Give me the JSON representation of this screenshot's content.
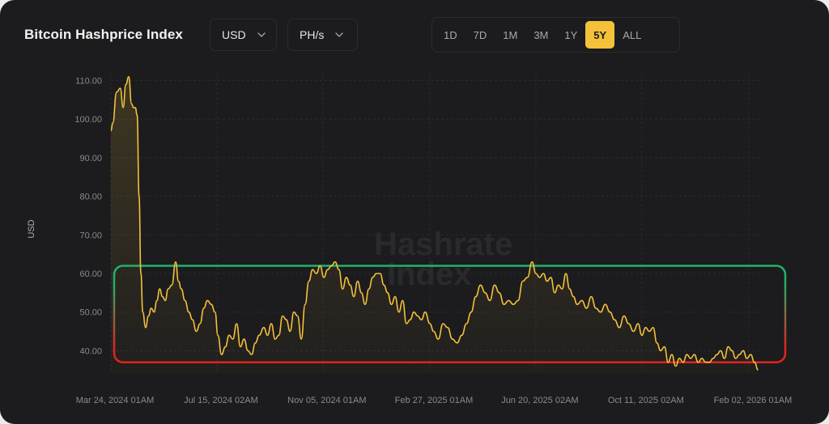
{
  "header": {
    "title": "Bitcoin Hashprice Index",
    "currency_select": "USD",
    "unit_select": "PH/s",
    "ranges": [
      "1D",
      "7D",
      "1M",
      "3M",
      "1Y",
      "5Y",
      "ALL"
    ],
    "active_range": "5Y"
  },
  "watermark": [
    "Hashrate",
    "Index"
  ],
  "colors": {
    "line": "#f3c13a",
    "accent": "#f3c13a",
    "band_top": "#1db36a",
    "band_bottom": "#e0251e",
    "background": "#1c1c1e"
  },
  "chart_data": {
    "type": "area",
    "ylabel": "USD",
    "ylim": [
      34,
      112
    ],
    "yticks": [
      40,
      50,
      60,
      70,
      80,
      90,
      100,
      110
    ],
    "ytick_labels": [
      "40.00",
      "50.00",
      "60.00",
      "70.00",
      "80.00",
      "90.00",
      "100.00",
      "110.00"
    ],
    "xlim": [
      "2024-03-24",
      "2026-02-15"
    ],
    "xticks": [
      "2024-03-24",
      "2024-07-15",
      "2024-11-05",
      "2025-02-27",
      "2025-06-20",
      "2025-10-11",
      "2026-02-02"
    ],
    "xtick_labels": [
      "Mar 24, 2024 01AM",
      "Jul 15, 2024 02AM",
      "Nov 05, 2024 01AM",
      "Feb 27, 2025 01AM",
      "Jun 20, 2025 02AM",
      "Oct 11, 2025 02AM",
      "Feb 02, 2026 01AM"
    ],
    "grid": true,
    "band": {
      "low": 37,
      "high": 62
    },
    "series": [
      {
        "x": [
          "2024-03-24",
          "2024-03-26",
          "2024-03-30",
          "2024-04-03",
          "2024-04-06",
          "2024-04-09",
          "2024-04-12",
          "2024-04-15",
          "2024-04-17",
          "2024-04-19",
          "2024-04-21",
          "2024-04-23",
          "2024-04-25",
          "2024-04-27",
          "2024-04-30",
          "2024-05-03",
          "2024-05-06",
          "2024-05-09",
          "2024-05-12",
          "2024-05-15",
          "2024-05-18",
          "2024-05-21",
          "2024-05-24",
          "2024-05-28",
          "2024-06-01",
          "2024-06-04",
          "2024-06-07",
          "2024-06-11",
          "2024-06-15",
          "2024-06-19",
          "2024-06-23",
          "2024-06-27",
          "2024-07-01",
          "2024-07-05",
          "2024-07-09",
          "2024-07-13",
          "2024-07-16",
          "2024-07-20",
          "2024-07-24",
          "2024-07-28",
          "2024-08-01",
          "2024-08-05",
          "2024-08-09",
          "2024-08-13",
          "2024-08-17",
          "2024-08-21",
          "2024-08-25",
          "2024-08-29",
          "2024-09-03",
          "2024-09-07",
          "2024-09-11",
          "2024-09-15",
          "2024-09-19",
          "2024-09-23",
          "2024-09-27",
          "2024-10-01",
          "2024-10-05",
          "2024-10-09",
          "2024-10-13",
          "2024-10-17",
          "2024-10-21",
          "2024-10-25",
          "2024-10-29",
          "2024-11-02",
          "2024-11-06",
          "2024-11-10",
          "2024-11-14",
          "2024-11-18",
          "2024-11-22",
          "2024-11-26",
          "2024-11-30",
          "2024-12-04",
          "2024-12-08",
          "2024-12-12",
          "2024-12-16",
          "2024-12-20",
          "2024-12-24",
          "2024-12-28",
          "2025-01-01",
          "2025-01-05",
          "2025-01-09",
          "2025-01-13",
          "2025-01-17",
          "2025-01-21",
          "2025-01-25",
          "2025-01-29",
          "2025-02-02",
          "2025-02-06",
          "2025-02-10",
          "2025-02-14",
          "2025-02-18",
          "2025-02-22",
          "2025-02-27",
          "2025-03-03",
          "2025-03-08",
          "2025-03-13",
          "2025-03-18",
          "2025-03-23",
          "2025-03-28",
          "2025-04-02",
          "2025-04-07",
          "2025-04-12",
          "2025-04-17",
          "2025-04-22",
          "2025-04-27",
          "2025-05-02",
          "2025-05-07",
          "2025-05-12",
          "2025-05-17",
          "2025-05-22",
          "2025-05-27",
          "2025-06-01",
          "2025-06-06",
          "2025-06-11",
          "2025-06-16",
          "2025-06-20",
          "2025-06-24",
          "2025-06-28",
          "2025-07-02",
          "2025-07-06",
          "2025-07-10",
          "2025-07-14",
          "2025-07-18",
          "2025-07-22",
          "2025-07-26",
          "2025-07-30",
          "2025-08-03",
          "2025-08-08",
          "2025-08-13",
          "2025-08-18",
          "2025-08-23",
          "2025-08-28",
          "2025-09-02",
          "2025-09-07",
          "2025-09-12",
          "2025-09-17",
          "2025-09-22",
          "2025-09-27",
          "2025-10-02",
          "2025-10-07",
          "2025-10-11",
          "2025-10-15",
          "2025-10-19",
          "2025-10-23",
          "2025-10-27",
          "2025-10-31",
          "2025-11-04",
          "2025-11-08",
          "2025-11-12",
          "2025-11-16",
          "2025-11-20",
          "2025-11-24",
          "2025-11-28",
          "2025-12-02",
          "2025-12-06",
          "2025-12-10",
          "2025-12-14",
          "2025-12-18",
          "2025-12-22",
          "2025-12-26",
          "2025-12-30",
          "2026-01-03",
          "2026-01-07",
          "2026-01-11",
          "2026-01-15",
          "2026-01-19",
          "2026-01-23",
          "2026-01-27",
          "2026-01-31",
          "2026-02-04",
          "2026-02-08",
          "2026-02-12"
        ],
        "y": [
          97,
          99,
          107,
          108,
          103,
          109,
          111,
          104,
          103,
          103,
          101,
          80,
          60,
          50,
          46,
          49,
          51,
          50,
          53,
          56,
          54,
          53,
          56,
          57,
          63,
          58,
          56,
          53,
          50,
          48,
          45,
          47,
          51,
          53,
          52,
          50,
          44,
          39,
          41,
          44,
          43,
          47,
          41,
          43,
          40,
          39,
          42,
          44,
          46,
          44,
          47,
          43,
          44,
          49,
          48,
          45,
          50,
          49,
          43,
          52,
          58,
          61,
          60,
          62,
          59,
          61,
          62,
          63,
          61,
          56,
          59,
          57,
          54,
          58,
          55,
          52,
          56,
          59,
          60,
          60,
          57,
          55,
          52,
          54,
          50,
          53,
          47,
          48,
          50,
          49,
          48,
          50,
          47,
          45,
          43,
          47,
          46,
          43,
          42,
          44,
          47,
          50,
          54,
          57,
          55,
          53,
          57,
          55,
          52,
          53,
          52,
          53,
          58,
          59,
          63,
          60,
          59,
          60,
          58,
          59,
          55,
          57,
          56,
          60,
          56,
          54,
          52,
          53,
          51,
          54,
          51,
          50,
          52,
          50,
          48,
          46,
          49,
          47,
          45,
          47,
          44,
          46,
          45,
          46,
          42,
          40,
          41,
          37,
          39,
          36,
          38,
          37,
          39,
          38,
          39,
          37,
          38,
          37,
          37,
          38,
          39,
          40,
          38,
          41,
          40,
          38,
          39,
          40,
          38,
          39,
          37,
          35
        ]
      }
    ]
  }
}
